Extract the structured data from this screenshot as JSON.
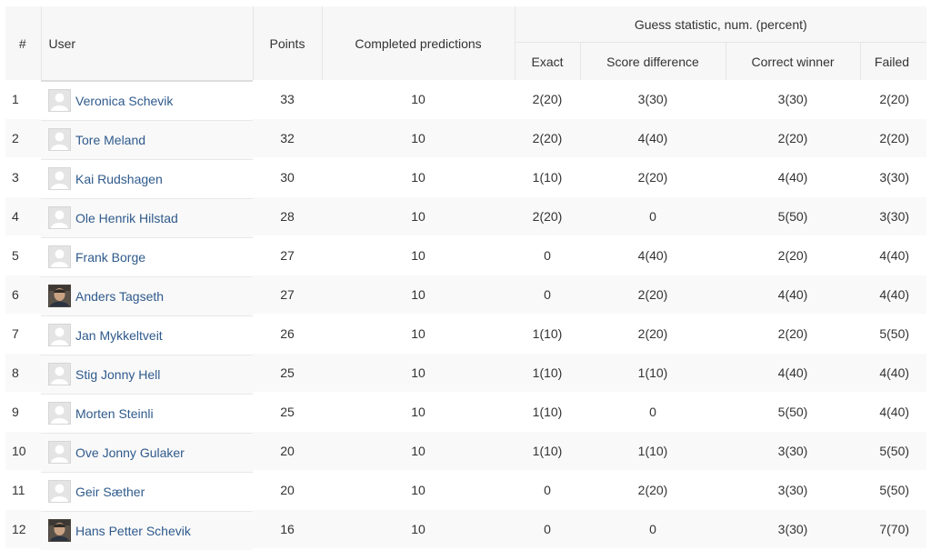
{
  "headers": {
    "rank": "#",
    "user": "User",
    "points": "Points",
    "completed": "Completed predictions",
    "group": "Guess statistic, num. (percent)",
    "exact": "Exact",
    "score_diff": "Score difference",
    "correct_winner": "Correct winner",
    "failed": "Failed"
  },
  "rows": [
    {
      "rank": "1",
      "name": "Veronica Schevik",
      "avatar": "default-avatar-icon",
      "points": "33",
      "completed": "10",
      "exact": "2(20)",
      "score_diff": "3(30)",
      "correct_winner": "3(30)",
      "failed": "2(20)"
    },
    {
      "rank": "2",
      "name": "Tore Meland",
      "avatar": "default-avatar-icon",
      "points": "32",
      "completed": "10",
      "exact": "2(20)",
      "score_diff": "4(40)",
      "correct_winner": "2(20)",
      "failed": "2(20)"
    },
    {
      "rank": "3",
      "name": "Kai Rudshagen",
      "avatar": "default-avatar-icon",
      "points": "30",
      "completed": "10",
      "exact": "1(10)",
      "score_diff": "2(20)",
      "correct_winner": "4(40)",
      "failed": "3(30)"
    },
    {
      "rank": "4",
      "name": "Ole Henrik Hilstad",
      "avatar": "default-avatar-icon",
      "points": "28",
      "completed": "10",
      "exact": "2(20)",
      "score_diff": "0",
      "correct_winner": "5(50)",
      "failed": "3(30)"
    },
    {
      "rank": "5",
      "name": "Frank Borge",
      "avatar": "default-avatar-icon",
      "points": "27",
      "completed": "10",
      "exact": "0",
      "score_diff": "4(40)",
      "correct_winner": "2(20)",
      "failed": "4(40)"
    },
    {
      "rank": "6",
      "name": "Anders Tagseth",
      "avatar": "photo-avatar-icon",
      "points": "27",
      "completed": "10",
      "exact": "0",
      "score_diff": "2(20)",
      "correct_winner": "4(40)",
      "failed": "4(40)"
    },
    {
      "rank": "7",
      "name": "Jan Mykkeltveit",
      "avatar": "default-avatar-icon",
      "points": "26",
      "completed": "10",
      "exact": "1(10)",
      "score_diff": "2(20)",
      "correct_winner": "2(20)",
      "failed": "5(50)"
    },
    {
      "rank": "8",
      "name": "Stig Jonny Hell",
      "avatar": "default-avatar-icon",
      "points": "25",
      "completed": "10",
      "exact": "1(10)",
      "score_diff": "1(10)",
      "correct_winner": "4(40)",
      "failed": "4(40)"
    },
    {
      "rank": "9",
      "name": "Morten Steinli",
      "avatar": "default-avatar-icon",
      "points": "25",
      "completed": "10",
      "exact": "1(10)",
      "score_diff": "0",
      "correct_winner": "5(50)",
      "failed": "4(40)"
    },
    {
      "rank": "10",
      "name": "Ove Jonny Gulaker",
      "avatar": "default-avatar-icon",
      "points": "20",
      "completed": "10",
      "exact": "1(10)",
      "score_diff": "1(10)",
      "correct_winner": "3(30)",
      "failed": "5(50)"
    },
    {
      "rank": "11",
      "name": "Geir Sæther",
      "avatar": "default-avatar-icon",
      "points": "20",
      "completed": "10",
      "exact": "0",
      "score_diff": "2(20)",
      "correct_winner": "3(30)",
      "failed": "5(50)"
    },
    {
      "rank": "12",
      "name": "Hans Petter Schevik",
      "avatar": "photo-avatar-icon",
      "points": "16",
      "completed": "10",
      "exact": "0",
      "score_diff": "0",
      "correct_winner": "3(30)",
      "failed": "7(70)"
    }
  ],
  "colors": {
    "link": "#2f5a8c",
    "text": "#333333",
    "header_bg": "#f7f7f7",
    "row_alt_bg": "#f9f9f9",
    "border": "#e6e6e6"
  }
}
